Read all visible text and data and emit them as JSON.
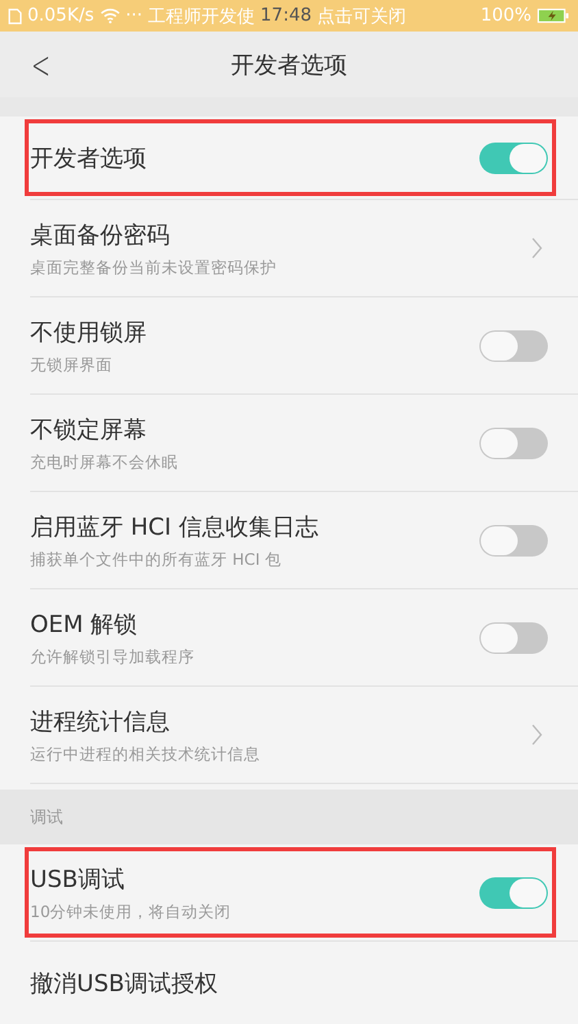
{
  "status_bar": {
    "speed": "0.05K/s",
    "dots": "···",
    "notice_left": "工程师开发使",
    "time": "17:48",
    "notice_right": "点击可关闭",
    "battery": "100%"
  },
  "header": {
    "back": "<",
    "title": "开发者选项"
  },
  "sections": [
    {
      "rows": [
        {
          "kind": "toggle",
          "title": "开发者选项",
          "on": true,
          "highlighted": true
        },
        {
          "kind": "link",
          "title": "桌面备份密码",
          "subtitle": "桌面完整备份当前未设置密码保护",
          "highlighted": false
        },
        {
          "kind": "toggle",
          "title": "不使用锁屏",
          "subtitle": "无锁屏界面",
          "on": false,
          "highlighted": false
        },
        {
          "kind": "toggle",
          "title": "不锁定屏幕",
          "subtitle": "充电时屏幕不会休眠",
          "on": false,
          "highlighted": false
        },
        {
          "kind": "toggle",
          "title": "启用蓝牙 HCI 信息收集日志",
          "subtitle": "捕获单个文件中的所有蓝牙 HCI 包",
          "on": false,
          "highlighted": false
        },
        {
          "kind": "toggle",
          "title": "OEM 解锁",
          "subtitle": "允许解锁引导加载程序",
          "on": false,
          "highlighted": false
        },
        {
          "kind": "link",
          "title": "进程统计信息",
          "subtitle": "运行中进程的相关技术统计信息",
          "highlighted": false
        }
      ]
    },
    {
      "title": "调试",
      "rows": [
        {
          "kind": "toggle",
          "title": "USB调试",
          "subtitle": "10分钟未使用，将自动关闭",
          "on": true,
          "highlighted": true
        },
        {
          "kind": "plain",
          "title": "撤消USB调试授权",
          "highlighted": false
        }
      ]
    }
  ]
}
